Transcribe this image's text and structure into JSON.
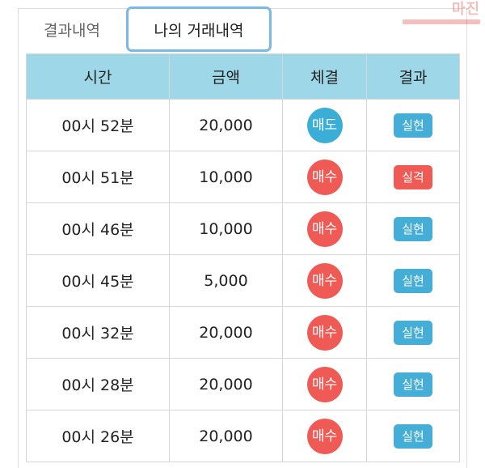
{
  "tabs": [
    {
      "label": "결과내역",
      "active": false
    },
    {
      "label": "나의 거래내역",
      "active": true
    }
  ],
  "watermark": "마진",
  "table": {
    "columns": [
      "시간",
      "금액",
      "체결",
      "결과"
    ],
    "rows": [
      {
        "time": "00시 52분",
        "amount": "20,000",
        "trade": "매도",
        "trade_type": "sell",
        "result": "실현",
        "result_type": "ok"
      },
      {
        "time": "00시 51분",
        "amount": "10,000",
        "trade": "매수",
        "trade_type": "buy",
        "result": "실격",
        "result_type": "fail"
      },
      {
        "time": "00시 46분",
        "amount": "10,000",
        "trade": "매수",
        "trade_type": "buy",
        "result": "실현",
        "result_type": "ok"
      },
      {
        "time": "00시 45분",
        "amount": "5,000",
        "trade": "매수",
        "trade_type": "buy",
        "result": "실현",
        "result_type": "ok"
      },
      {
        "time": "00시 32분",
        "amount": "20,000",
        "trade": "매수",
        "trade_type": "buy",
        "result": "실현",
        "result_type": "ok"
      },
      {
        "time": "00시 28분",
        "amount": "20,000",
        "trade": "매수",
        "trade_type": "buy",
        "result": "실현",
        "result_type": "ok"
      },
      {
        "time": "00시 26분",
        "amount": "20,000",
        "trade": "매수",
        "trade_type": "buy",
        "result": "실현",
        "result_type": "ok"
      }
    ]
  },
  "colors": {
    "header_bg": "#9ed8e8",
    "sell": "#3aaed6",
    "buy": "#ef5a55",
    "result_ok": "#44aed6",
    "result_fail": "#ef5a55",
    "active_tab_border": "#7ab8e6"
  }
}
